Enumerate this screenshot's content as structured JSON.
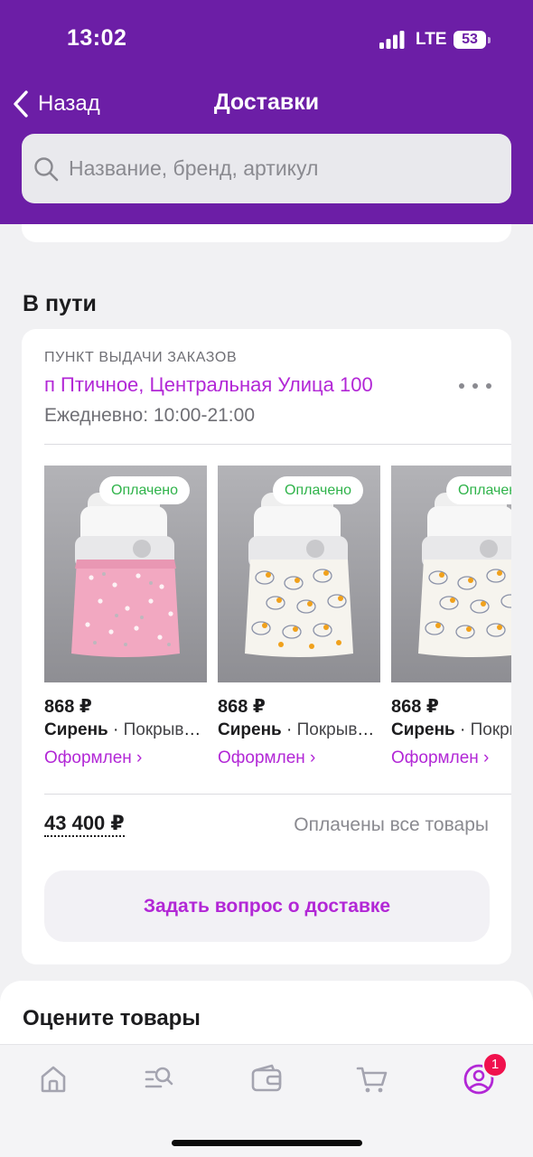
{
  "status_bar": {
    "time": "13:02",
    "network": "LTE",
    "battery": "53"
  },
  "nav": {
    "back_label": "Назад",
    "title": "Доставки"
  },
  "search": {
    "placeholder": "Название, бренд, артикул"
  },
  "section": {
    "title": "В пути"
  },
  "pickup": {
    "caption": "ПУНКТ ВЫДАЧИ ЗАКАЗОВ",
    "address": "п Птичное, Центральная Улица 100",
    "hours": "Ежедневно: 10:00-21:00"
  },
  "products": [
    {
      "badge": "Оплачено",
      "price": "868 ₽",
      "brand": "Сирень",
      "separator": " · ",
      "name": "Покрывало",
      "status": "Оформлен ›",
      "pattern": "pink-stars"
    },
    {
      "badge": "Оплачено",
      "price": "868 ₽",
      "brand": "Сирень",
      "separator": " · ",
      "name": "Покрывало",
      "status": "Оформлен ›",
      "pattern": "ducks"
    },
    {
      "badge": "Оплачено",
      "price": "868 ₽",
      "brand": "Сирень",
      "separator": " · ",
      "name": "Покрывало",
      "status": "Оформлен ›",
      "pattern": "ducks"
    }
  ],
  "summary": {
    "total": "43 400 ₽",
    "paid_status": "Оплачены все товары"
  },
  "ask_button": {
    "label": "Задать вопрос о доставке"
  },
  "rate": {
    "title": "Оцените товары"
  },
  "tabbar": {
    "items": [
      {
        "icon": "home-icon"
      },
      {
        "icon": "catalog-search-icon"
      },
      {
        "icon": "wallet-icon"
      },
      {
        "icon": "cart-icon"
      },
      {
        "icon": "profile-icon",
        "badge": "1",
        "active": true
      }
    ]
  },
  "colors": {
    "header": "#6c1ea6",
    "accent": "#b227d6",
    "paid_green": "#2fb34a",
    "badge_red": "#f0114d"
  }
}
